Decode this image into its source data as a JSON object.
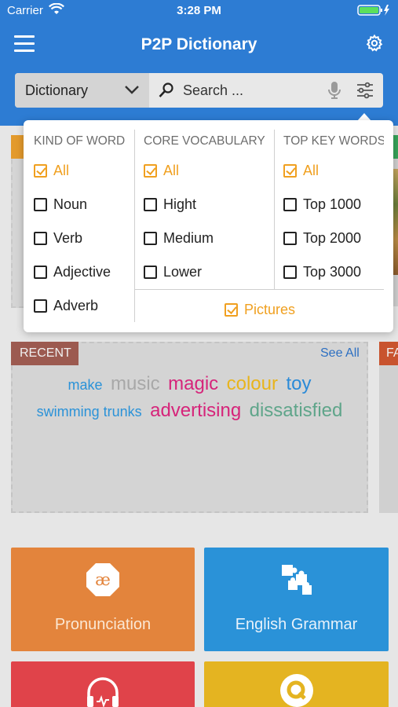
{
  "status_bar": {
    "carrier": "Carrier",
    "time": "3:28 PM"
  },
  "header": {
    "title": "P2P Dictionary"
  },
  "search": {
    "dictionary_select": "Dictionary",
    "placeholder": "Search ..."
  },
  "filter_popover": {
    "kind_of_word": {
      "heading": "KIND OF WORD",
      "options": [
        {
          "label": "All",
          "checked": true
        },
        {
          "label": "Noun",
          "checked": false
        },
        {
          "label": "Verb",
          "checked": false
        },
        {
          "label": "Adjective",
          "checked": false
        },
        {
          "label": "Adverb",
          "checked": false
        }
      ]
    },
    "core_vocabulary": {
      "heading": "CORE VOCABULARY",
      "options": [
        {
          "label": "All",
          "checked": true
        },
        {
          "label": "Hight",
          "checked": false
        },
        {
          "label": "Medium",
          "checked": false
        },
        {
          "label": "Lower",
          "checked": false
        }
      ]
    },
    "top_key_words": {
      "heading": "TOP KEY WORDS",
      "options": [
        {
          "label": "All",
          "checked": true
        },
        {
          "label": "Top 1000",
          "checked": false
        },
        {
          "label": "Top 2000",
          "checked": false
        },
        {
          "label": "Top 3000",
          "checked": false
        }
      ]
    },
    "pictures": {
      "label": "Pictures",
      "checked": true
    }
  },
  "recent": {
    "label": "RECENT",
    "see_all": "See All",
    "words": [
      {
        "text": "make",
        "color": "#2a92d8"
      },
      {
        "text": "music",
        "color": "#a8a8a8"
      },
      {
        "text": "magic",
        "color": "#d6247a"
      },
      {
        "text": "colour",
        "color": "#e8b41c"
      },
      {
        "text": "toy",
        "color": "#2a8ad8"
      },
      {
        "text": "swimming trunks",
        "color": "#2a92d8"
      },
      {
        "text": "advertising",
        "color": "#d6247a"
      },
      {
        "text": "dissatisfied",
        "color": "#5fa58a"
      }
    ]
  },
  "favorites": {
    "label": "FA"
  },
  "tiles": {
    "pronunciation": "Pronunciation",
    "grammar": "English Grammar"
  },
  "colors": {
    "primary": "#2d7cd3",
    "accent": "#f0a020"
  }
}
